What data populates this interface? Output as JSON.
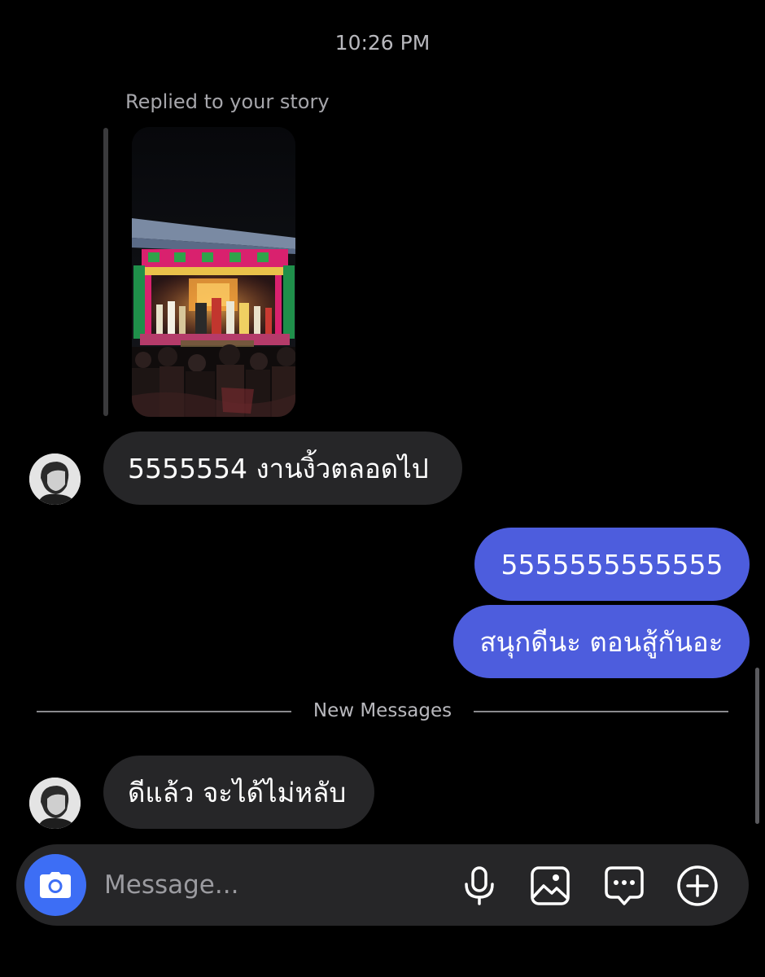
{
  "conversation": {
    "timestamp": "10:26 PM",
    "story_reply": {
      "label": "Replied to your story",
      "thumbnail_icon": "story-photo-chinese-opera-stage"
    },
    "messages": [
      {
        "direction": "incoming",
        "text": "5555554 งานงิ้วตลอดไป"
      },
      {
        "direction": "outgoing",
        "text": "5555555555555"
      },
      {
        "direction": "outgoing",
        "text": "สนุกดีนะ ตอนสู้กันอะ"
      },
      {
        "direction": "incoming",
        "text": "ดีแล้ว จะได้ไม่หลับ"
      }
    ],
    "new_messages_label": "New Messages"
  },
  "composer": {
    "placeholder": "Message...",
    "icons": [
      "camera-icon",
      "microphone-icon",
      "gallery-icon",
      "sticker-chat-icon",
      "plus-icon"
    ]
  },
  "colors": {
    "background": "#000000",
    "incoming_bubble": "#262628",
    "outgoing_bubble": "#4d5ddd",
    "camera_button": "#3d6ef5"
  }
}
